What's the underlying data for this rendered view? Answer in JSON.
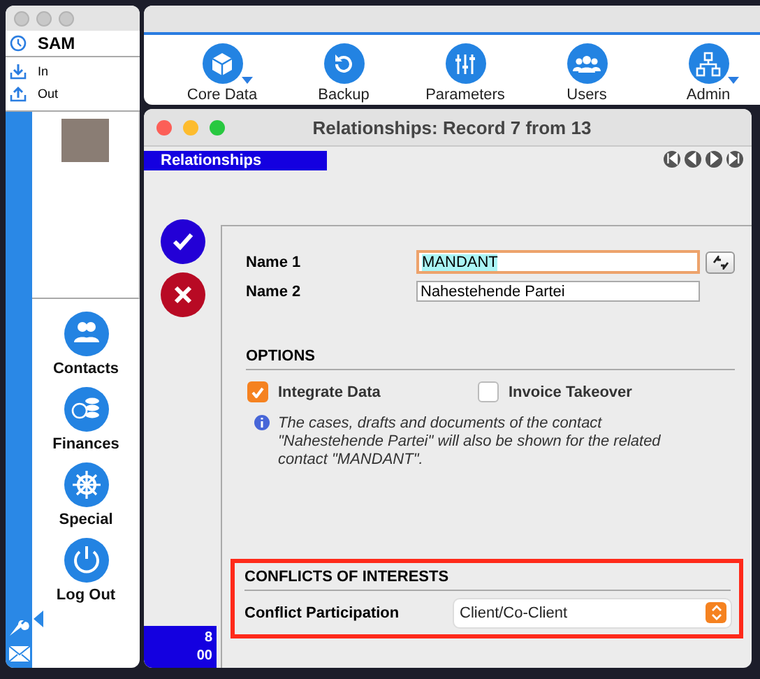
{
  "launcher": {
    "user": "SAM",
    "items": [
      {
        "label": "In",
        "kind": "in"
      },
      {
        "label": "Out",
        "kind": "out"
      }
    ],
    "nav": [
      {
        "label": "Contacts",
        "kind": "contacts"
      },
      {
        "label": "Finances",
        "kind": "finances"
      },
      {
        "label": "Special",
        "kind": "special"
      },
      {
        "label": "Log Out",
        "kind": "logout"
      }
    ]
  },
  "toolbar": {
    "buttons": [
      {
        "label": "Core Data",
        "kind": "cube",
        "has_menu": true
      },
      {
        "label": "Backup",
        "kind": "backup",
        "has_menu": false
      },
      {
        "label": "Parameters",
        "kind": "sliders",
        "has_menu": false
      },
      {
        "label": "Users",
        "kind": "users",
        "has_menu": false
      },
      {
        "label": "Admin",
        "kind": "admin",
        "has_menu": true
      }
    ]
  },
  "record_window": {
    "title": "Relationships: Record 7 from 13",
    "tabs": [
      {
        "label": "Relationships",
        "selected": true
      }
    ],
    "counter": [
      "8",
      "00"
    ],
    "fields": [
      {
        "label": "Name 1",
        "value": "MANDANT",
        "focused": true,
        "swap": true
      },
      {
        "label": "Name 2",
        "value": "Nahestehende Partei",
        "focused": false,
        "swap": false
      }
    ],
    "options": {
      "title": "OPTIONS",
      "checkboxes": [
        {
          "label": "Integrate Data",
          "checked": true
        },
        {
          "label": "Invoice Takeover",
          "checked": false
        }
      ],
      "info": "The cases, drafts and documents of the contact \"Nahestehende Partei\" will also be shown for the related contact \"MANDANT\"."
    },
    "conflicts": {
      "title": "CONFLICTS OF INTERESTS",
      "highlighted": true,
      "label": "Conflict Participation",
      "value": "Client/Co-Client"
    }
  }
}
